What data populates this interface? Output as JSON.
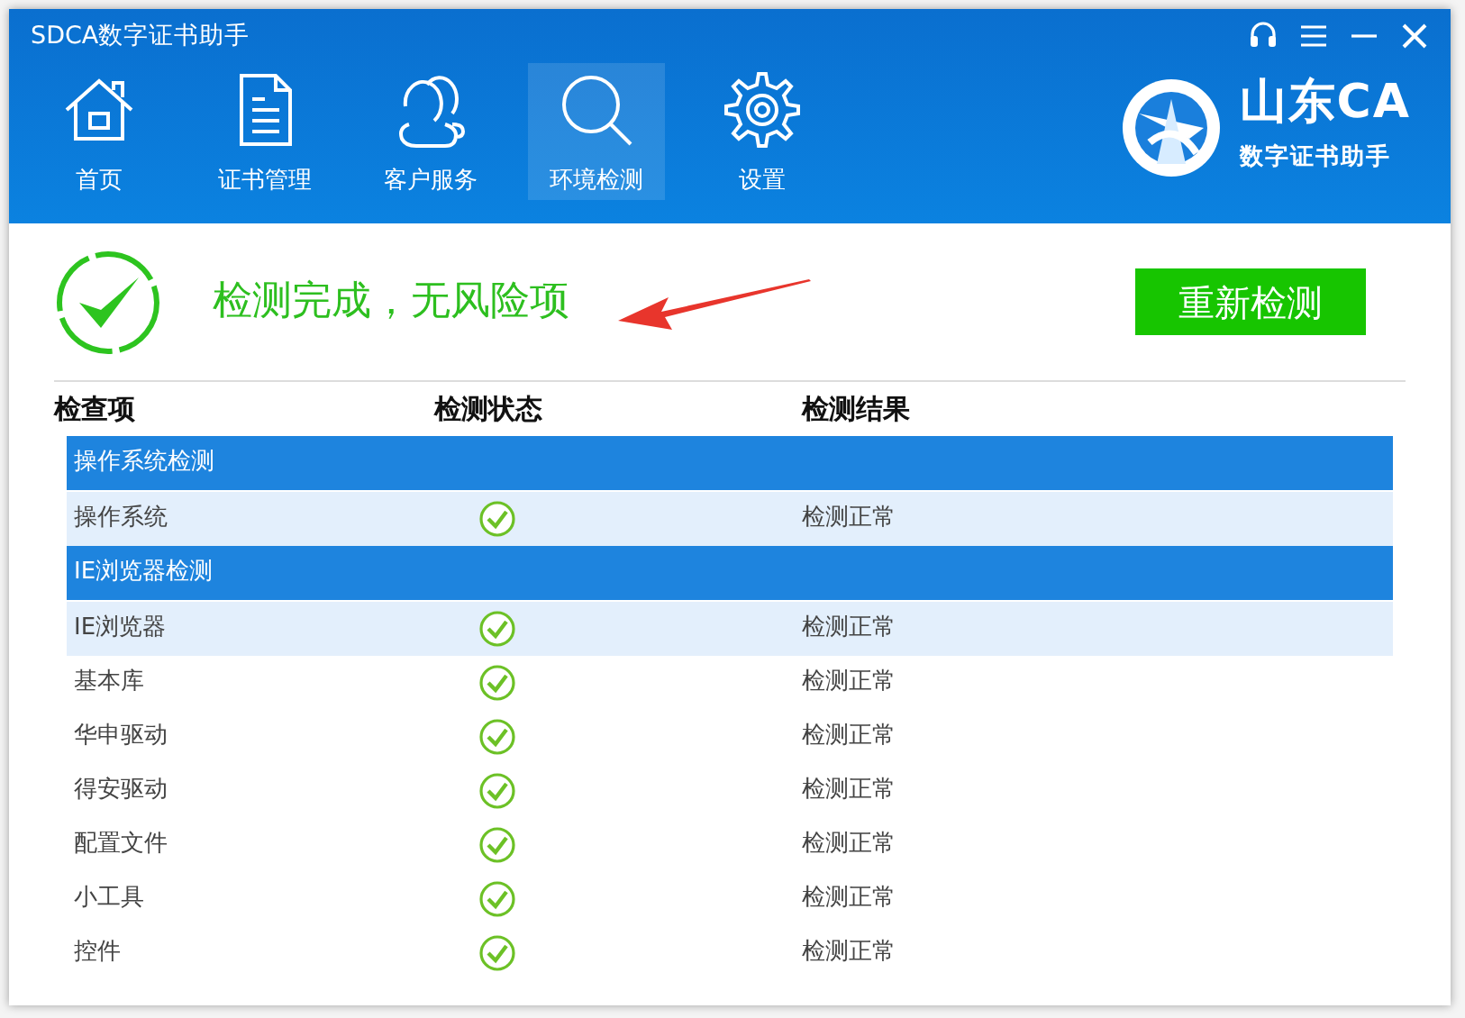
{
  "window": {
    "title": "SDCA数字证书助手"
  },
  "nav": [
    {
      "label": "首页",
      "selected": false
    },
    {
      "label": "证书管理",
      "selected": false
    },
    {
      "label": "客户服务",
      "selected": false
    },
    {
      "label": "环境检测",
      "selected": true
    },
    {
      "label": "设置",
      "selected": false
    }
  ],
  "brand": {
    "name": "山东CA",
    "subtitle": "数字证书助手"
  },
  "summary": {
    "message": "检测完成，无风险项",
    "button": "重新检测"
  },
  "table": {
    "columns": [
      "检查项",
      "检测状态",
      "检测结果"
    ],
    "groups": [
      {
        "title": "操作系统检测",
        "rows": [
          {
            "item": "操作系统",
            "passed": true,
            "result": "检测正常",
            "selected": true
          }
        ]
      },
      {
        "title": "IE浏览器检测",
        "rows": [
          {
            "item": "IE浏览器",
            "passed": true,
            "result": "检测正常",
            "selected": true
          },
          {
            "item": "基本库",
            "passed": true,
            "result": "检测正常",
            "selected": false
          },
          {
            "item": "华申驱动",
            "passed": true,
            "result": "检测正常",
            "selected": false
          },
          {
            "item": "得安驱动",
            "passed": true,
            "result": "检测正常",
            "selected": false
          },
          {
            "item": "配置文件",
            "passed": true,
            "result": "检测正常",
            "selected": false
          },
          {
            "item": "小工具",
            "passed": true,
            "result": "检测正常",
            "selected": false
          },
          {
            "item": "控件",
            "passed": true,
            "result": "检测正常",
            "selected": false
          }
        ]
      }
    ]
  }
}
